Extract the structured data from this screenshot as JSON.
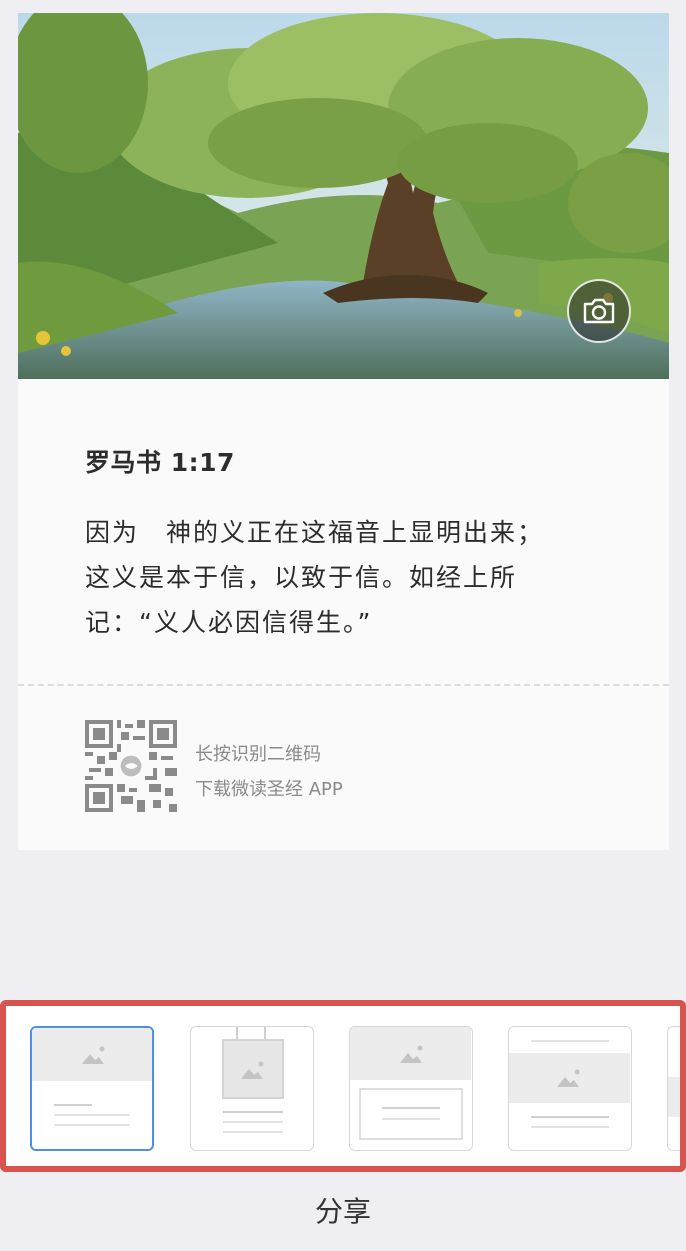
{
  "card": {
    "reference": "罗马书 1:17",
    "verse_lines": [
      "因为　神的义正在这福音上显明出来；",
      "这义是本于信，以致于信。如经上所",
      "记：“义人必因信得生。”"
    ],
    "qr_hint": "长按识别二维码",
    "download_hint": "下载微读圣经 APP"
  },
  "template_picker": {
    "templates": [
      "template-1",
      "template-2",
      "template-3",
      "template-4",
      "template-5"
    ],
    "selected_index": 0
  },
  "share_label": "分享",
  "colors": {
    "selection_border": "#4f8fe8",
    "highlight_frame": "#d9534f",
    "background": "#efeef3"
  }
}
